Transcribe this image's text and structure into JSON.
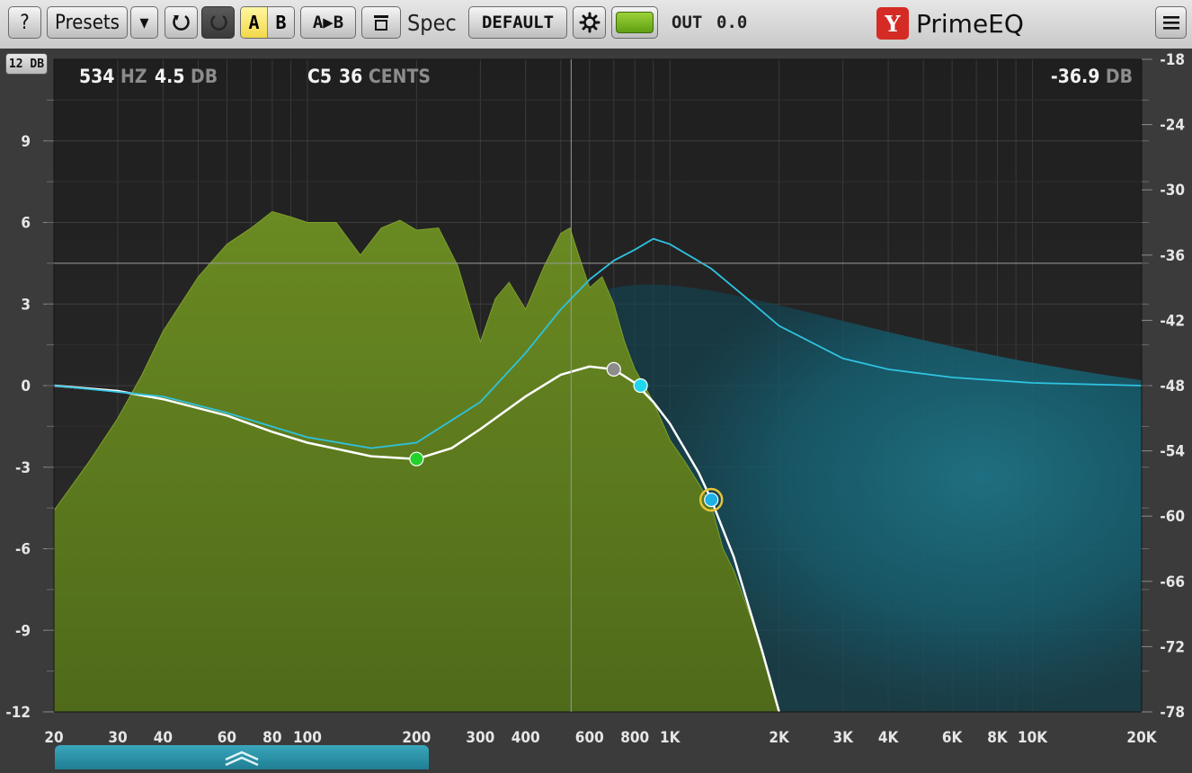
{
  "toolbar": {
    "help_label": "?",
    "presets_label": "Presets",
    "presets_dropdown": "▾",
    "undo_icon": "undo-icon",
    "redo_icon": "redo-icon",
    "a_label": "A",
    "b_label": "B",
    "copy_ab_label": "A▶B",
    "layout_icon": "layout-icon",
    "spec_label": "Spec",
    "spec_mode_value": "DEFAULT",
    "settings_icon": "gear-icon",
    "out_label": "OUT",
    "out_value": "0.0",
    "brand_logo": "Y",
    "brand_name": "PrimeEQ",
    "menu_icon": "hamburger-menu-icon"
  },
  "readout": {
    "freq_value": "534",
    "freq_unit": "HZ",
    "gain_value": "4.5",
    "gain_unit": "DB",
    "note_value": "C5",
    "cents_value": "36",
    "cents_unit": "CENTS",
    "level_value": "-36.9",
    "level_unit": "DB"
  },
  "range_button": "12 DB",
  "colors": {
    "spectrum_fill": "#5f7e1e",
    "spectrum_teal": "#1b7a8c",
    "eq_curve": "#ffffff",
    "band_curve": "#2ec3e0",
    "grid_bg": "#242424"
  },
  "chart_data": {
    "type": "line",
    "x_scale": "log",
    "xlim": [
      20,
      20000
    ],
    "ylim_left": [
      -12,
      12
    ],
    "ylim_right": [
      -78,
      -18
    ],
    "x_ticks": [
      20,
      30,
      40,
      60,
      80,
      100,
      200,
      300,
      400,
      600,
      800,
      1000,
      2000,
      3000,
      4000,
      6000,
      8000,
      10000,
      20000
    ],
    "x_tick_labels": [
      "20",
      "30",
      "40",
      "60",
      "80",
      "100",
      "200",
      "300",
      "400",
      "600",
      "800",
      "1K",
      "2K",
      "3K",
      "4K",
      "6K",
      "8K",
      "10K",
      "20K"
    ],
    "y_left_ticks": [
      9,
      6,
      3,
      0,
      -3,
      -6,
      -9,
      -12
    ],
    "y_left_tick_labels": [
      "9",
      "6",
      "3",
      "0",
      "-3",
      "-6",
      "-9",
      "-12"
    ],
    "y_right_ticks": [
      -18,
      -24,
      -30,
      -36,
      -42,
      -48,
      -54,
      -60,
      -66,
      -72,
      -78
    ],
    "y_right_tick_labels": [
      "-18",
      "-24",
      "-30",
      "-36",
      "-42",
      "-48",
      "-54",
      "-60",
      "-66",
      "-72",
      "-78"
    ],
    "eq_curve": {
      "name": "",
      "x": [
        20,
        30,
        40,
        60,
        80,
        100,
        150,
        200,
        250,
        300,
        400,
        500,
        600,
        700,
        800,
        900,
        1000,
        1200,
        1300,
        1500,
        1800,
        2000
      ],
      "y": [
        0,
        -0.2,
        -0.5,
        -1.1,
        -1.7,
        -2.1,
        -2.6,
        -2.7,
        -2.3,
        -1.6,
        -0.4,
        0.4,
        0.7,
        0.6,
        0.1,
        -0.6,
        -1.4,
        -3.2,
        -4.2,
        -6.3,
        -9.8,
        -12
      ]
    },
    "band_curve": {
      "name": "",
      "x": [
        20,
        40,
        60,
        100,
        150,
        200,
        300,
        400,
        500,
        600,
        700,
        800,
        900,
        1000,
        1300,
        1600,
        2000,
        3000,
        4000,
        6000,
        10000,
        20000
      ],
      "y": [
        0,
        -0.4,
        -1.0,
        -1.9,
        -2.3,
        -2.1,
        -0.6,
        1.2,
        2.8,
        3.9,
        4.6,
        5.0,
        5.4,
        5.2,
        4.3,
        3.3,
        2.2,
        1.0,
        0.6,
        0.3,
        0.1,
        0
      ]
    },
    "spectrum": {
      "name": "",
      "x": [
        20,
        25,
        30,
        35,
        40,
        50,
        60,
        70,
        80,
        90,
        100,
        120,
        140,
        160,
        180,
        200,
        230,
        260,
        300,
        330,
        360,
        400,
        450,
        500,
        530,
        560,
        600,
        650,
        700,
        750,
        800,
        850,
        900,
        1000,
        1100,
        1200,
        1300,
        1400,
        1500,
        1700,
        1900,
        2000
      ],
      "y": [
        -59.5,
        -55,
        -51,
        -47,
        -43,
        -38,
        -35,
        -33.5,
        -32,
        -32.5,
        -33,
        -33,
        -36,
        -33.5,
        -32.8,
        -33.7,
        -33.5,
        -37,
        -44,
        -40,
        -38.5,
        -41,
        -37,
        -34,
        -33.5,
        -36,
        -39,
        -38,
        -40.5,
        -44,
        -46.5,
        -48,
        -49.5,
        -53,
        -55,
        -57,
        -59,
        -63,
        -65,
        -70,
        -75,
        -78
      ]
    },
    "bands": [
      {
        "freq": 200,
        "gain": -2.7,
        "color": "#23d12b"
      },
      {
        "freq": 700,
        "gain": 0.6,
        "color": "#8c8c8c"
      },
      {
        "freq": 830,
        "gain": 0.0,
        "color": "#1fd6ee"
      },
      {
        "freq": 1300,
        "gain": -4.2,
        "color": "#1fb0e6"
      }
    ],
    "cursor": {
      "freq": 534,
      "gain": 4.5
    }
  },
  "bottom_handle_icon": "chevron-up-double-icon"
}
